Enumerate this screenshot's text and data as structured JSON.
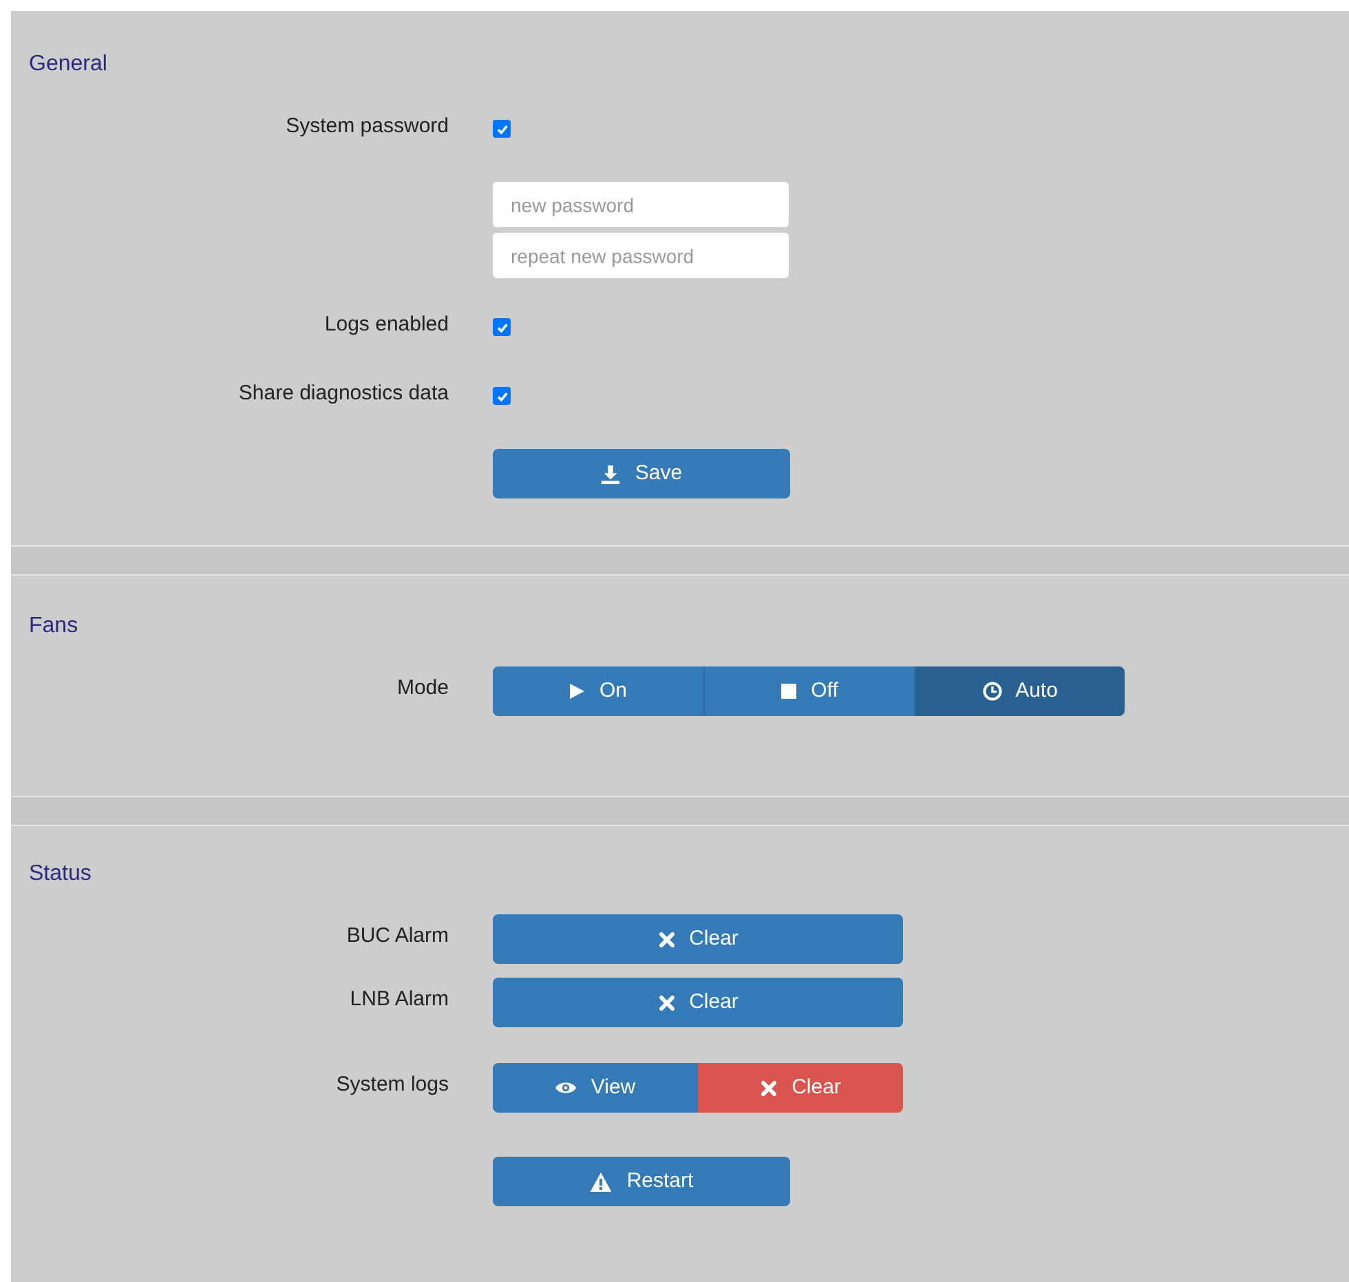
{
  "sections": [
    {
      "title": "General",
      "rows": [
        {
          "kind": "checkbox",
          "label": "System password",
          "checked": true
        },
        {
          "kind": "fields",
          "fields": [
            {
              "placeholder": "new password"
            },
            {
              "placeholder": "repeat new password"
            }
          ]
        },
        {
          "kind": "checkbox",
          "label": "Logs enabled",
          "checked": true
        },
        {
          "kind": "checkbox",
          "label": "Share diagnostics data",
          "checked": true
        },
        {
          "kind": "buttons",
          "buttons": [
            {
              "kind": "save",
              "label": "Save",
              "color": "#337ab7"
            }
          ]
        }
      ]
    },
    {
      "title": "Fans",
      "rows": [
        {
          "kind": "segmented",
          "label": "Mode",
          "options": [
            {
              "kind": "play",
              "label": "On",
              "selected": false
            },
            {
              "kind": "stop",
              "label": "Off",
              "selected": false
            },
            {
              "kind": "clock",
              "label": "Auto",
              "selected": true
            }
          ]
        }
      ]
    },
    {
      "title": "Status",
      "rows": [
        {
          "kind": "buttons",
          "label": "BUC Alarm",
          "buttons": [
            {
              "kind": "clear",
              "label": "Clear",
              "color": "#337ab7"
            }
          ]
        },
        {
          "kind": "buttons",
          "label": "LNB Alarm",
          "buttons": [
            {
              "kind": "clear",
              "label": "Clear",
              "color": "#337ab7"
            }
          ]
        },
        {
          "kind": "buttons",
          "label": "System logs",
          "buttons": [
            {
              "kind": "view",
              "label": "View",
              "color": "#337ab7"
            },
            {
              "kind": "clear",
              "label": "Clear",
              "color": "#d9534f"
            }
          ]
        },
        {
          "kind": "buttons",
          "buttons": [
            {
              "kind": "restart",
              "label": "Restart",
              "color": "#337ab7"
            }
          ]
        }
      ]
    }
  ]
}
